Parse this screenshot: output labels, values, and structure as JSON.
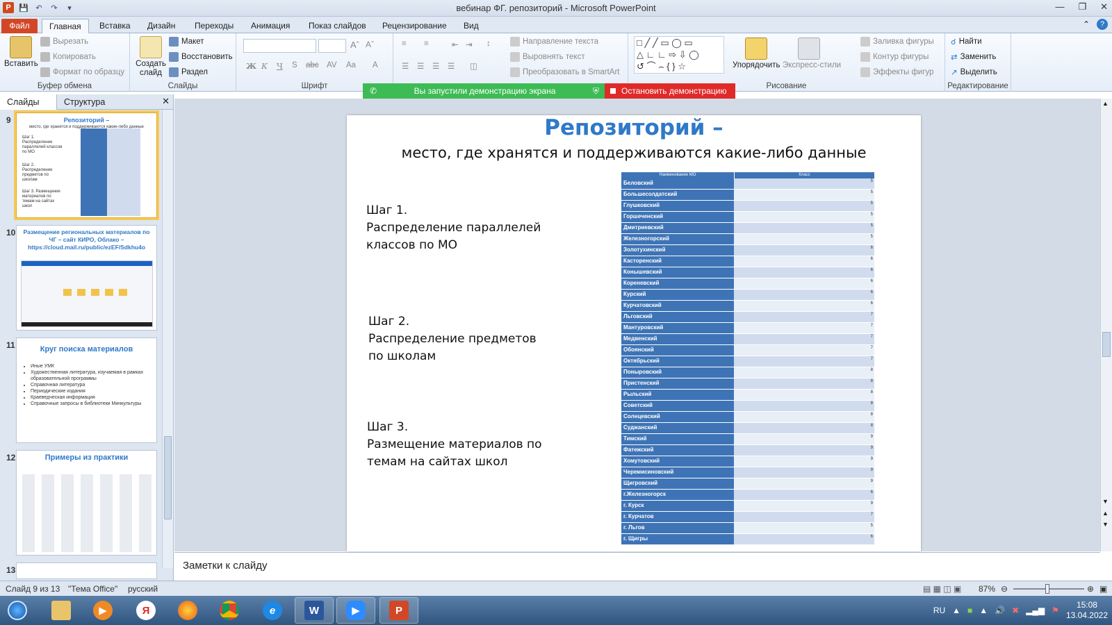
{
  "window": {
    "title": "вебинар ФГ. репозиторий  -  Microsoft PowerPoint"
  },
  "ribbon_tabs": [
    "Файл",
    "Главная",
    "Вставка",
    "Дизайн",
    "Переходы",
    "Анимация",
    "Показ слайдов",
    "Рецензирование",
    "Вид"
  ],
  "ribbon": {
    "clipboard": {
      "paste": "Вставить",
      "cut": "Вырезать",
      "copy": "Копировать",
      "format": "Формат по образцу",
      "label": "Буфер обмена"
    },
    "slides": {
      "new": "Создать слайд",
      "layout": "Макет",
      "reset": "Восстановить",
      "section": "Раздел",
      "label": "Слайды"
    },
    "font": {
      "label": "Шрифт"
    },
    "paragraph": {
      "text_dir": "Направление текста",
      "align_text": "Выровнять текст",
      "smartart": "Преобразовать в SmartArt"
    },
    "drawing": {
      "arrange": "Упорядочить",
      "quick_styles": "Экспресс-стили",
      "fill": "Заливка фигуры",
      "outline": "Контур фигуры",
      "effects": "Эффекты фигур",
      "label": "Рисование"
    },
    "editing": {
      "find": "Найти",
      "replace": "Заменить",
      "select": "Выделить",
      "label": "Редактирование"
    }
  },
  "screenshare": {
    "status": "Вы запустили демонстрацию экрана",
    "stop": "Остановить демонстрацию"
  },
  "left_pane": {
    "tabs": [
      "Слайды",
      "Структура"
    ],
    "thumbs": [
      {
        "num": "9",
        "title": "Репозиторий –",
        "sub": "место, где хранятся и поддерживаются какие-либо данные",
        "steps": [
          "Шаг 1. Распределение параллелей классов по МО",
          "Шаг 2. Распределение предметов по школам",
          "Шаг 3. Размещение материалов по темам на сайтах школ"
        ]
      },
      {
        "num": "10",
        "title": "Размещение региональных материалов по ЧГ – сайт КИРО, Облако – https://cloud.mail.ru/public/ezEF/Sdkhu4o"
      },
      {
        "num": "11",
        "title": "Круг поиска материалов",
        "bullets": [
          "Иные УМК",
          "Художественная литература, изучаемая в рамках образовательной программы",
          "Справочная литература",
          "Периодические издания",
          "Краеведческая информация",
          "Справочные запросы в библиотеки Минкультуры"
        ]
      },
      {
        "num": "12",
        "title": "Примеры из практики"
      },
      {
        "num": "13"
      }
    ]
  },
  "slide": {
    "title": "Репозиторий –",
    "subtitle": "место, где хранятся и поддерживаются какие-либо данные",
    "step1": [
      "Шаг 1.",
      "Распределение параллелей",
      "классов по МО"
    ],
    "step2": [
      "Шаг 2.",
      "Распределение предметов",
      "по школам"
    ],
    "step3": [
      "Шаг 3.",
      "Размещение материалов по",
      "темам на сайтах школ"
    ],
    "table": {
      "headers": [
        "Наименование МО",
        "Класс"
      ],
      "rows": [
        [
          "Беловский",
          "5"
        ],
        [
          "Большесолдатский",
          "5"
        ],
        [
          "Глушковский",
          "5"
        ],
        [
          "Горшеченский",
          "5"
        ],
        [
          "Дмитриевский",
          "5"
        ],
        [
          "Железногорский",
          "5"
        ],
        [
          "Золотухинский",
          "6"
        ],
        [
          "Касторенский",
          "6"
        ],
        [
          "Конышевский",
          "6"
        ],
        [
          "Кореневский",
          "6"
        ],
        [
          "Курский",
          "6"
        ],
        [
          "Курчатовский",
          "6"
        ],
        [
          "Льговский",
          "7"
        ],
        [
          "Мантуровский",
          "7"
        ],
        [
          "Медвенский",
          "7"
        ],
        [
          "Обоянский",
          "7"
        ],
        [
          "Октябрьский",
          "7"
        ],
        [
          "Поныровский",
          "8"
        ],
        [
          "Пристенский",
          "8"
        ],
        [
          "Рыльский",
          "8"
        ],
        [
          "Советский",
          "8"
        ],
        [
          "Солнцевский",
          "8"
        ],
        [
          "Суджанский",
          "8"
        ],
        [
          "Тимский",
          "9"
        ],
        [
          "Фатежский",
          "9"
        ],
        [
          "Хомутовский",
          "9"
        ],
        [
          "Черемисиновский",
          "9"
        ],
        [
          "Щигровский",
          "9"
        ],
        [
          "г.Железногорск",
          "6"
        ],
        [
          "г. Курск",
          "9"
        ],
        [
          "г. Курчатов",
          "7"
        ],
        [
          "г. Льгов",
          "5"
        ],
        [
          "г. Щигры",
          "6"
        ]
      ]
    }
  },
  "notes": {
    "placeholder": "Заметки к слайду"
  },
  "status": {
    "slide": "Слайд 9 из 13",
    "theme": "\"Тема Office\"",
    "lang": "русский",
    "zoom": "87%"
  },
  "taskbar": {
    "lang": "RU",
    "time": "15:08",
    "date": "13.04.2022"
  }
}
